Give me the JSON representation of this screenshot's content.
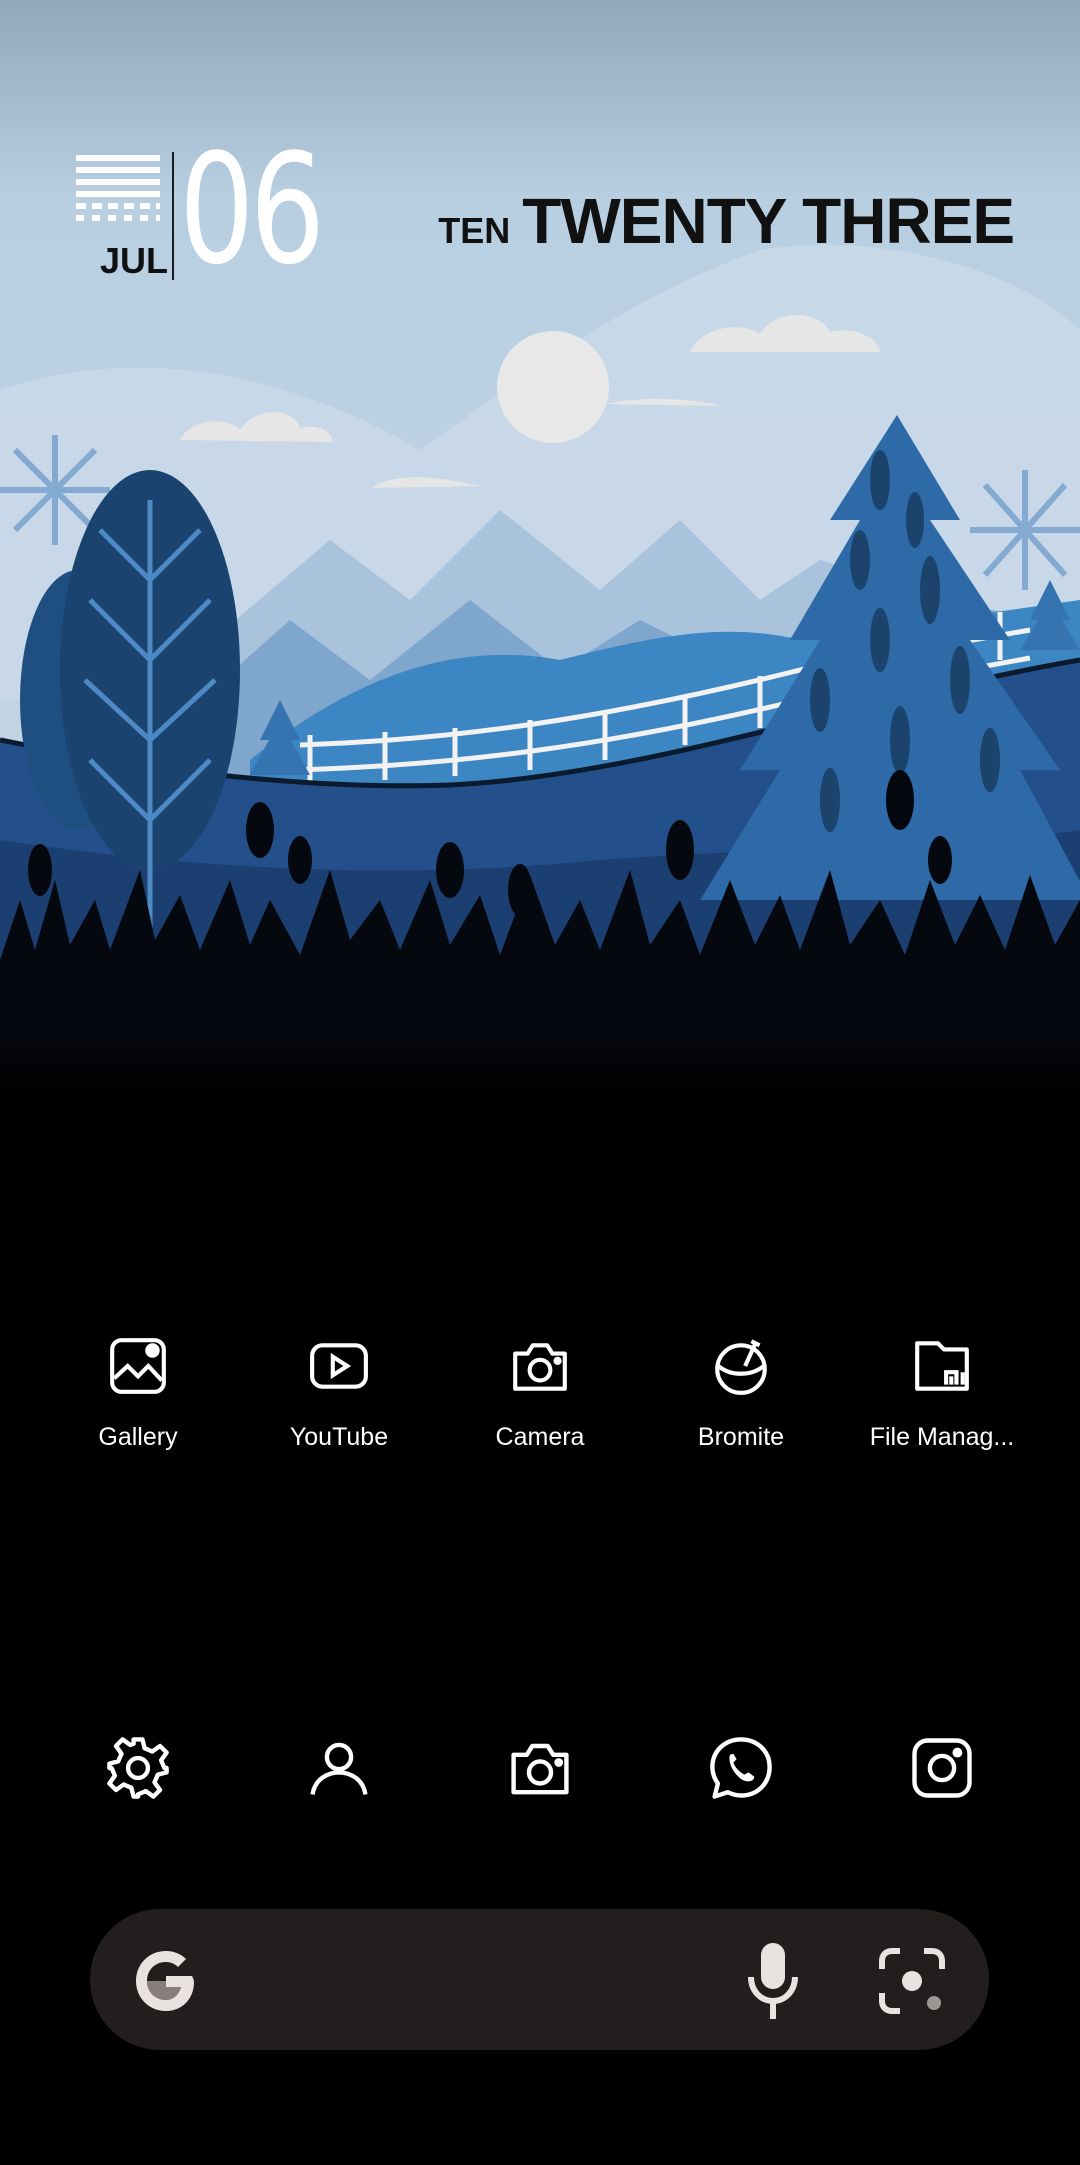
{
  "clock": {
    "month": "JUL",
    "day": "06",
    "hour_words": "TEN",
    "minute_words": "TWENTY THREE"
  },
  "apps": [
    {
      "label": "Gallery",
      "icon": "gallery-icon"
    },
    {
      "label": "YouTube",
      "icon": "youtube-icon"
    },
    {
      "label": "Camera",
      "icon": "camera-icon"
    },
    {
      "label": "Bromite",
      "icon": "bromite-icon"
    },
    {
      "label": "File Manag...",
      "icon": "file-manager-icon"
    }
  ],
  "dock": [
    {
      "icon": "settings-icon"
    },
    {
      "icon": "contacts-icon"
    },
    {
      "icon": "camera-icon"
    },
    {
      "icon": "whatsapp-icon"
    },
    {
      "icon": "instagram-icon"
    }
  ],
  "search": {
    "logo_icon": "google-g-icon",
    "voice_icon": "microphone-icon",
    "lens_icon": "google-lens-icon"
  },
  "colors": {
    "background": "#000000",
    "search_bar": "#221e1d",
    "sky": "#b5cfe2",
    "accent_blue": "#2f6ea8"
  }
}
